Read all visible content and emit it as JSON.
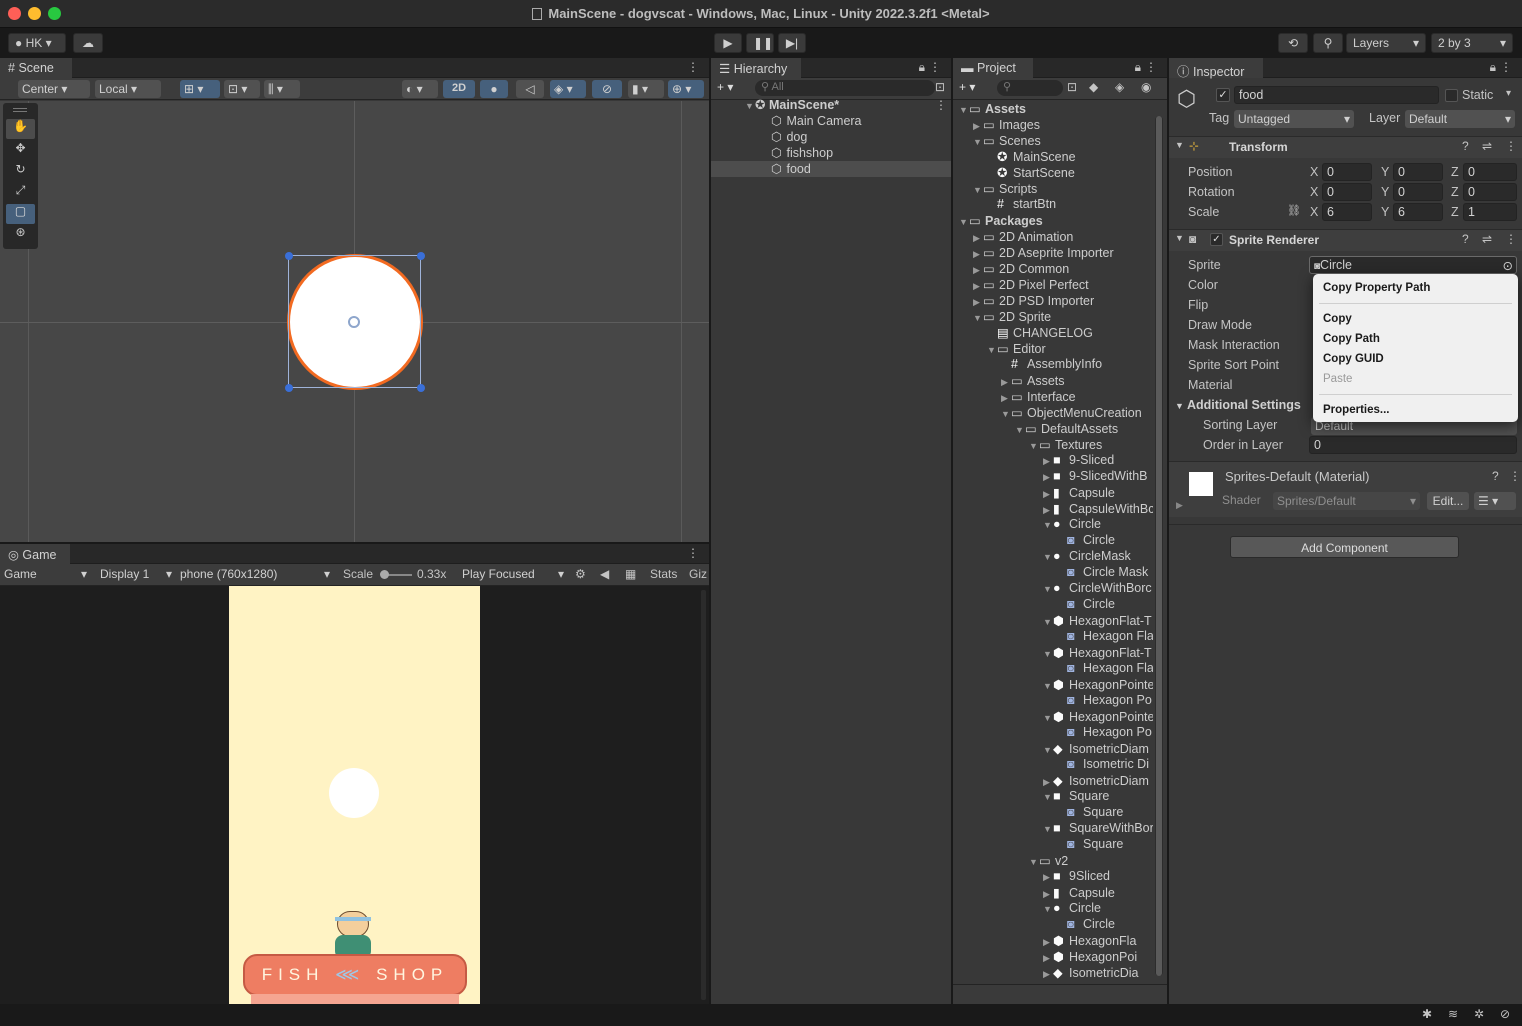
{
  "window": {
    "title": "MainScene - dogvscat - Windows, Mac, Linux - Unity 2022.3.2f1 <Metal>"
  },
  "toolbar": {
    "account": "HK",
    "layers": "Layers",
    "layout": "2 by 3"
  },
  "scene": {
    "tab": "Scene",
    "pivot": "Center",
    "space": "Local",
    "mode2d": "2D"
  },
  "game": {
    "tab": "Game",
    "view": "Game",
    "display": "Display 1",
    "resolution": "phone (760x1280)",
    "scale_label": "Scale",
    "scale_value": "0.33x",
    "play_mode": "Play Focused",
    "stats": "Stats",
    "gizmos": "Giz",
    "shop_left": "FISH",
    "shop_right": "SHOP"
  },
  "hierarchy": {
    "tab": "Hierarchy",
    "search_placeholder": "All",
    "scene": "MainScene*",
    "items": [
      "Main Camera",
      "dog",
      "fishshop",
      "food"
    ],
    "selected": "food"
  },
  "project": {
    "tab": "Project",
    "tree": [
      {
        "label": "Assets",
        "depth": 0,
        "exp": "open",
        "icon": "folder-icon",
        "bold": true
      },
      {
        "label": "Images",
        "depth": 1,
        "exp": "closed",
        "icon": "folder-icon"
      },
      {
        "label": "Scenes",
        "depth": 1,
        "exp": "open",
        "icon": "folder-icon"
      },
      {
        "label": "MainScene",
        "depth": 2,
        "exp": "none",
        "icon": "unity-scene-icon"
      },
      {
        "label": "StartScene",
        "depth": 2,
        "exp": "none",
        "icon": "unity-scene-icon"
      },
      {
        "label": "Scripts",
        "depth": 1,
        "exp": "open",
        "icon": "folder-icon"
      },
      {
        "label": "startBtn",
        "depth": 2,
        "exp": "none",
        "icon": "script-icon"
      },
      {
        "label": "Packages",
        "depth": 0,
        "exp": "open",
        "icon": "folder-icon",
        "bold": true
      },
      {
        "label": "2D Animation",
        "depth": 1,
        "exp": "closed",
        "icon": "folder-icon"
      },
      {
        "label": "2D Aseprite Importer",
        "depth": 1,
        "exp": "closed",
        "icon": "folder-icon"
      },
      {
        "label": "2D Common",
        "depth": 1,
        "exp": "closed",
        "icon": "folder-icon"
      },
      {
        "label": "2D Pixel Perfect",
        "depth": 1,
        "exp": "closed",
        "icon": "folder-icon"
      },
      {
        "label": "2D PSD Importer",
        "depth": 1,
        "exp": "closed",
        "icon": "folder-icon"
      },
      {
        "label": "2D Sprite",
        "depth": 1,
        "exp": "open",
        "icon": "folder-icon"
      },
      {
        "label": "CHANGELOG",
        "depth": 2,
        "exp": "none",
        "icon": "document-icon"
      },
      {
        "label": "Editor",
        "depth": 2,
        "exp": "open",
        "icon": "folder-icon"
      },
      {
        "label": "AssemblyInfo",
        "depth": 3,
        "exp": "none",
        "icon": "script-icon"
      },
      {
        "label": "Assets",
        "depth": 3,
        "exp": "closed",
        "icon": "folder-icon"
      },
      {
        "label": "Interface",
        "depth": 3,
        "exp": "closed",
        "icon": "folder-icon"
      },
      {
        "label": "ObjectMenuCreation",
        "depth": 3,
        "exp": "open",
        "icon": "folder-icon"
      },
      {
        "label": "DefaultAssets",
        "depth": 4,
        "exp": "open",
        "icon": "folder-icon"
      },
      {
        "label": "Textures",
        "depth": 5,
        "exp": "open",
        "icon": "folder-icon"
      },
      {
        "label": "9-Sliced",
        "depth": 6,
        "exp": "closed",
        "icon": "rounded-square-icon"
      },
      {
        "label": "9-SlicedWithB",
        "depth": 6,
        "exp": "closed",
        "icon": "square-icon"
      },
      {
        "label": "Capsule",
        "depth": 6,
        "exp": "closed",
        "icon": "capsule-icon"
      },
      {
        "label": "CapsuleWithBc",
        "depth": 6,
        "exp": "closed",
        "icon": "capsule-icon"
      },
      {
        "label": "Circle",
        "depth": 6,
        "exp": "open",
        "icon": "circle-icon"
      },
      {
        "label": "Circle",
        "depth": 7,
        "exp": "none",
        "icon": "sprite-icon"
      },
      {
        "label": "CircleMask",
        "depth": 6,
        "exp": "open",
        "icon": "circle-icon"
      },
      {
        "label": "Circle Mask",
        "depth": 7,
        "exp": "none",
        "icon": "sprite-icon"
      },
      {
        "label": "CircleWithBorc",
        "depth": 6,
        "exp": "open",
        "icon": "circle-icon"
      },
      {
        "label": "Circle",
        "depth": 7,
        "exp": "none",
        "icon": "sprite-icon"
      },
      {
        "label": "HexagonFlat-T",
        "depth": 6,
        "exp": "open",
        "icon": "hexagon-icon"
      },
      {
        "label": "Hexagon Fla",
        "depth": 7,
        "exp": "none",
        "icon": "sprite-icon"
      },
      {
        "label": "HexagonFlat-T",
        "depth": 6,
        "exp": "open",
        "icon": "hexagon-icon"
      },
      {
        "label": "Hexagon Fla",
        "depth": 7,
        "exp": "none",
        "icon": "sprite-icon"
      },
      {
        "label": "HexagonPointe",
        "depth": 6,
        "exp": "open",
        "icon": "hexagon-icon"
      },
      {
        "label": "Hexagon Po",
        "depth": 7,
        "exp": "none",
        "icon": "sprite-icon"
      },
      {
        "label": "HexagonPointe",
        "depth": 6,
        "exp": "open",
        "icon": "hexagon-icon"
      },
      {
        "label": "Hexagon Po",
        "depth": 7,
        "exp": "none",
        "icon": "sprite-icon"
      },
      {
        "label": "IsometricDiam",
        "depth": 6,
        "exp": "open",
        "icon": "diamond-icon"
      },
      {
        "label": "Isometric Di",
        "depth": 7,
        "exp": "none",
        "icon": "sprite-icon"
      },
      {
        "label": "IsometricDiam",
        "depth": 6,
        "exp": "closed",
        "icon": "diamond-icon"
      },
      {
        "label": "Square",
        "depth": 6,
        "exp": "open",
        "icon": "square-icon"
      },
      {
        "label": "Square",
        "depth": 7,
        "exp": "none",
        "icon": "sprite-icon"
      },
      {
        "label": "SquareWithBor",
        "depth": 6,
        "exp": "open",
        "icon": "square-icon"
      },
      {
        "label": "Square",
        "depth": 7,
        "exp": "none",
        "icon": "sprite-icon"
      },
      {
        "label": "v2",
        "depth": 5,
        "exp": "open",
        "icon": "folder-icon"
      },
      {
        "label": "9Sliced",
        "depth": 6,
        "exp": "closed",
        "icon": "rounded-square-icon"
      },
      {
        "label": "Capsule",
        "depth": 6,
        "exp": "closed",
        "icon": "capsule-icon"
      },
      {
        "label": "Circle",
        "depth": 6,
        "exp": "open",
        "icon": "circle-icon"
      },
      {
        "label": "Circle",
        "depth": 7,
        "exp": "none",
        "icon": "sprite-icon"
      },
      {
        "label": "HexagonFla",
        "depth": 6,
        "exp": "closed",
        "icon": "hexagon-icon"
      },
      {
        "label": "HexagonPoi",
        "depth": 6,
        "exp": "closed",
        "icon": "hexagon-icon"
      },
      {
        "label": "IsometricDia",
        "depth": 6,
        "exp": "closed",
        "icon": "diamond-icon"
      }
    ]
  },
  "inspector": {
    "tab": "Inspector",
    "object_name": "food",
    "static_label": "Static",
    "tag_label": "Tag",
    "tag_value": "Untagged",
    "layer_label": "Layer",
    "layer_value": "Default",
    "transform": {
      "title": "Transform",
      "position": {
        "label": "Position",
        "x": "0",
        "y": "0",
        "z": "0"
      },
      "rotation": {
        "label": "Rotation",
        "x": "0",
        "y": "0",
        "z": "0"
      },
      "scale": {
        "label": "Scale",
        "x": "6",
        "y": "6",
        "z": "1"
      }
    },
    "sprite_renderer": {
      "title": "Sprite Renderer",
      "sprite_label": "Sprite",
      "sprite_value": "Circle",
      "props": [
        "Color",
        "Flip",
        "Draw Mode",
        "Mask Interaction",
        "Sprite Sort Point",
        "Material"
      ],
      "additional": "Additional Settings",
      "sorting_layer": "Sorting Layer",
      "sorting_value": "Default",
      "order_label": "Order in Layer",
      "order_value": "0"
    },
    "material": {
      "title": "Sprites-Default (Material)",
      "shader_label": "Shader",
      "shader_value": "Sprites/Default",
      "edit": "Edit..."
    },
    "add_component": "Add Component"
  },
  "context_menu": {
    "items": [
      "Copy Property Path",
      "Copy",
      "Copy Path",
      "Copy GUID",
      "Paste",
      "Properties..."
    ]
  }
}
